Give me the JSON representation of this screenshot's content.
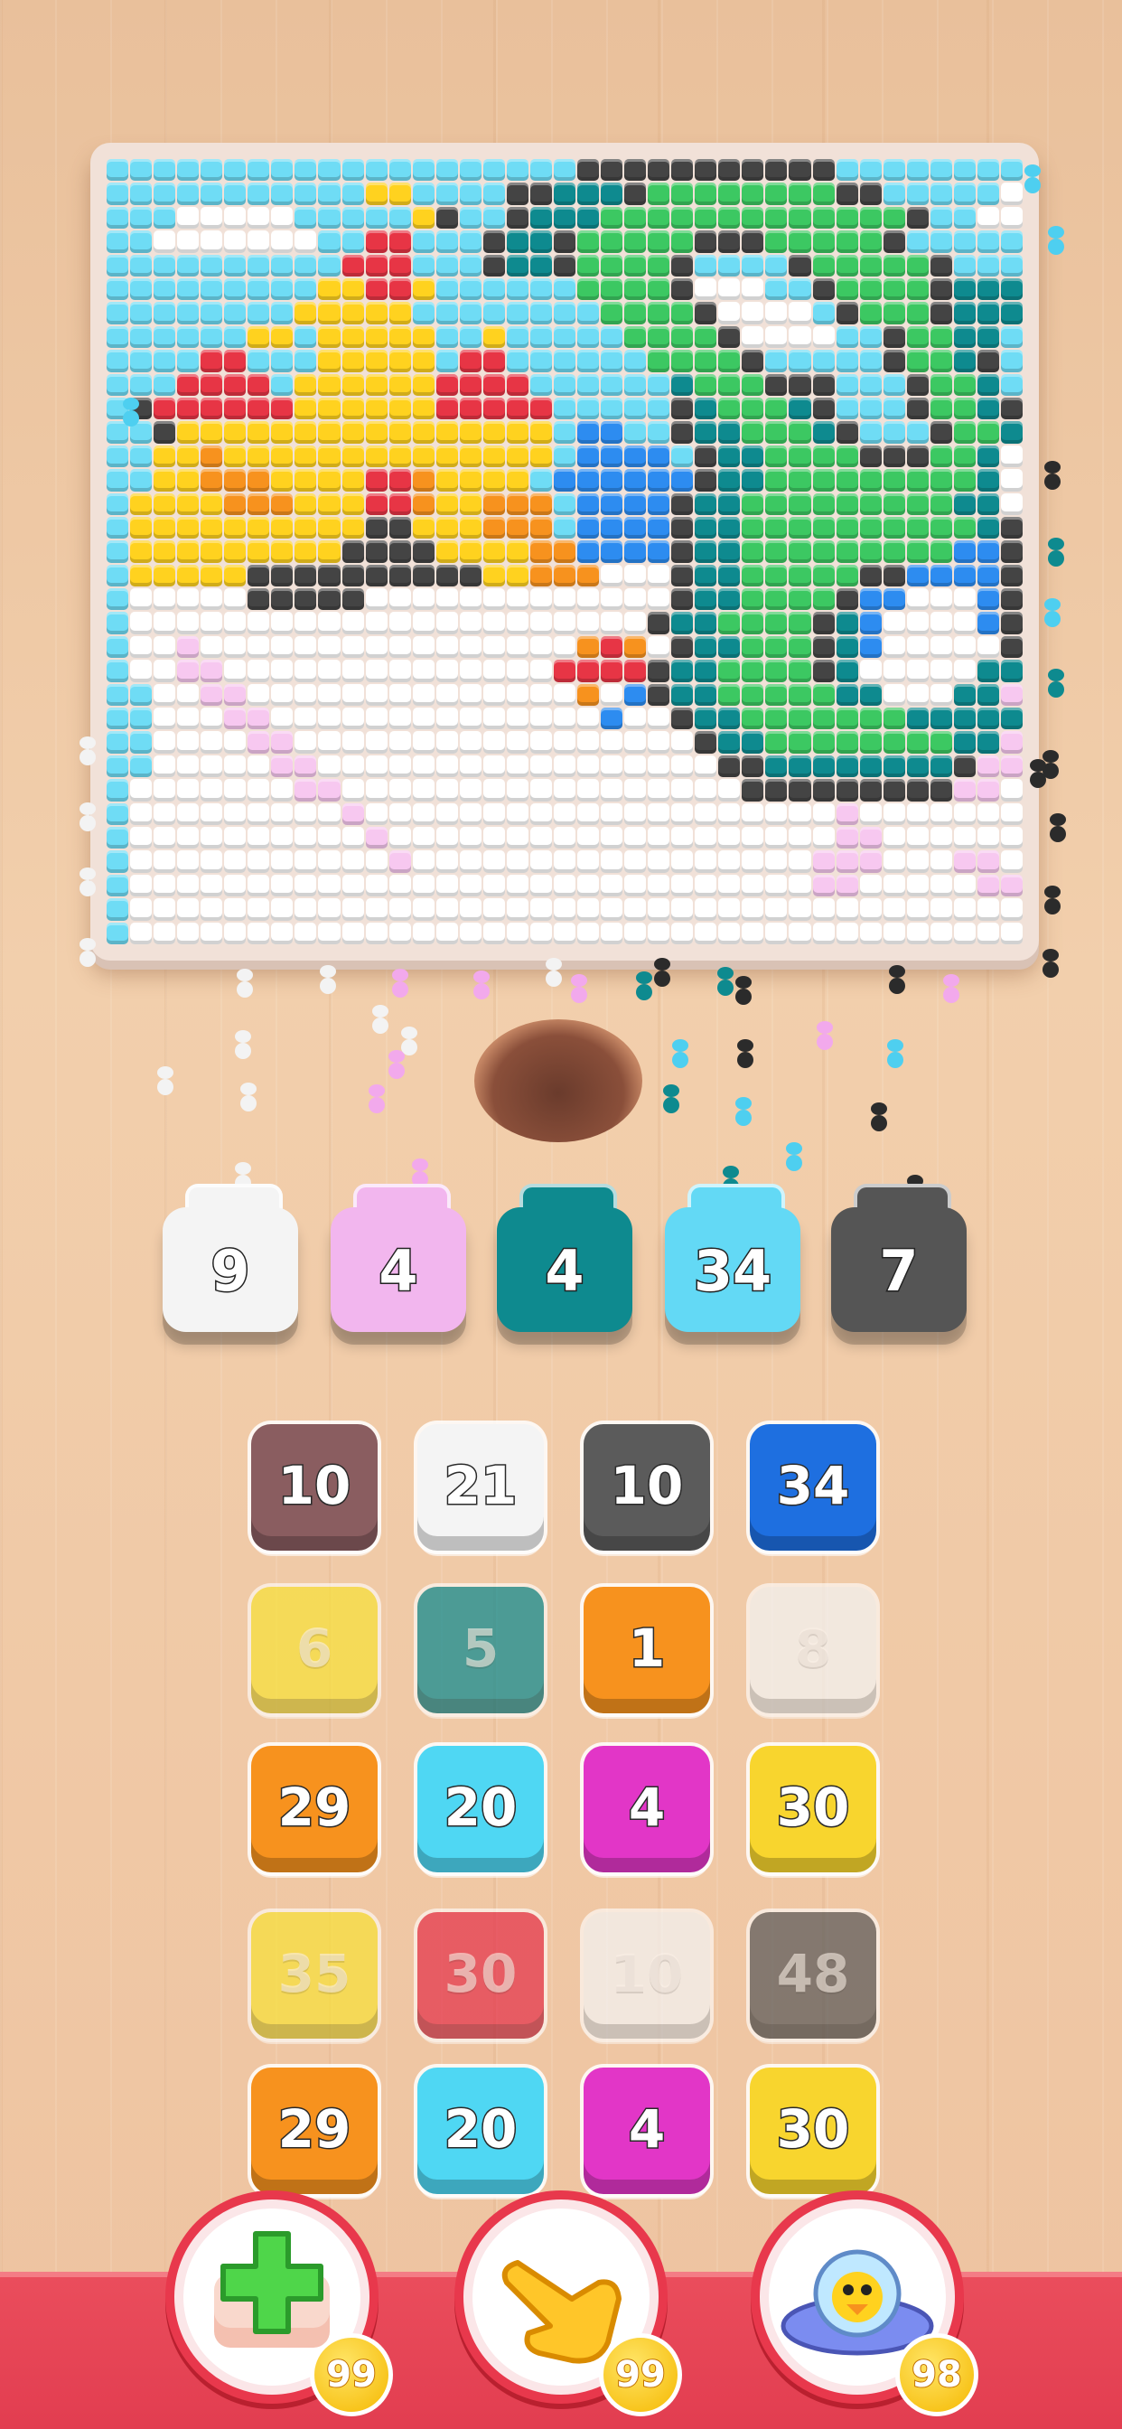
{
  "bins": [
    {
      "count": "9",
      "color": "#f4f4f4"
    },
    {
      "count": "4",
      "color": "#f2b6ee"
    },
    {
      "count": "4",
      "color": "#0e8a8f"
    },
    {
      "count": "34",
      "color": "#63d9f5"
    },
    {
      "count": "7",
      "color": "#555555"
    }
  ],
  "tiles": [
    {
      "value": "10",
      "color": "#8a5d60",
      "dim": false
    },
    {
      "value": "21",
      "color": "#f4f4f4",
      "dim": false
    },
    {
      "value": "10",
      "color": "#5b5b5b",
      "dim": false
    },
    {
      "value": "34",
      "color": "#1e6fe0",
      "dim": false
    },
    {
      "value": "6",
      "color": "#f8e13a",
      "dim": true
    },
    {
      "value": "5",
      "color": "#0e8a8f",
      "dim": true
    },
    {
      "value": "1",
      "color": "#f7921e",
      "dim": false
    },
    {
      "value": "8",
      "color": "#f4f4f4",
      "dim": true
    },
    {
      "value": "29",
      "color": "#f7921e",
      "dim": false
    },
    {
      "value": "20",
      "color": "#4fd7f3",
      "dim": false
    },
    {
      "value": "4",
      "color": "#e236c7",
      "dim": false
    },
    {
      "value": "30",
      "color": "#f8d52e",
      "dim": false
    },
    {
      "value": "35",
      "color": "#f8e13a",
      "dim": true
    },
    {
      "value": "30",
      "color": "#e5334b",
      "dim": true
    },
    {
      "value": "10",
      "color": "#f4f4f4",
      "dim": true
    },
    {
      "value": "48",
      "color": "#5b5b5b",
      "dim": true
    },
    {
      "value": "29",
      "color": "#f7921e",
      "dim": false
    },
    {
      "value": "20",
      "color": "#4fd7f3",
      "dim": false
    },
    {
      "value": "4",
      "color": "#e236c7",
      "dim": false
    },
    {
      "value": "30",
      "color": "#f8d52e",
      "dim": false
    }
  ],
  "boosters": [
    {
      "icon": "green-plus-icon",
      "count": "99"
    },
    {
      "icon": "pointing-hand-icon",
      "count": "99"
    },
    {
      "icon": "ufo-bird-icon",
      "count": "98"
    }
  ],
  "palette": {
    "sky": "#6fdcf5",
    "cloud": "#ffffff",
    "outline": "#444444",
    "green": "#3cc862",
    "teal": "#0e8a8f",
    "blue": "#2d8cf0",
    "yellow": "#ffd21f",
    "orange": "#f7921e",
    "red": "#e73545",
    "pink": "#f7c8f0",
    "lightblue": "#9fe6fb"
  }
}
